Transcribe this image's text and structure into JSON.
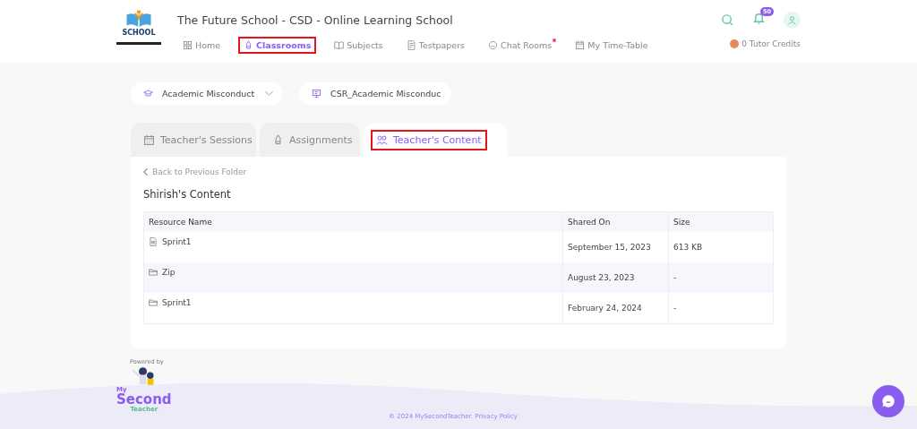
{
  "header": {
    "logo_text": "SCHOOL",
    "school_name": "The Future School - CSD - Online Learning School",
    "notification_count": "50",
    "tutor_credits": "0 Tutor Credits"
  },
  "nav": [
    {
      "label": "Home",
      "selected": false,
      "annotated": false,
      "dot": false
    },
    {
      "label": "Classrooms",
      "selected": true,
      "annotated": true,
      "dot": false
    },
    {
      "label": "Subjects",
      "selected": false,
      "annotated": false,
      "dot": false
    },
    {
      "label": "Testpapers",
      "selected": false,
      "annotated": false,
      "dot": false
    },
    {
      "label": "Chat Rooms",
      "selected": false,
      "annotated": false,
      "dot": true
    },
    {
      "label": "My Time-Table",
      "selected": false,
      "annotated": false,
      "dot": false
    }
  ],
  "dropdowns": [
    {
      "value": "Academic Misconduct"
    },
    {
      "value": "CSR_Academic Misconduc"
    }
  ],
  "tabs": [
    {
      "label": "Teacher's Sessions",
      "selected": false,
      "annotated": false
    },
    {
      "label": "Assignments",
      "selected": false,
      "annotated": false
    },
    {
      "label": "Teacher's Content",
      "selected": true,
      "annotated": true
    }
  ],
  "content": {
    "back_link": "Back to Previous Folder",
    "title": "Shirish's Content",
    "table": {
      "columns": [
        "Resource Name",
        "Shared On",
        "Size"
      ],
      "rows": [
        {
          "kind": "file",
          "cells": [
            "Sprint1",
            "September 15, 2023",
            "613 KB"
          ]
        },
        {
          "kind": "folder",
          "cells": [
            "Zip",
            "August 23, 2023",
            "-"
          ]
        },
        {
          "kind": "folder",
          "cells": [
            "Sprint1",
            "February 24, 2024",
            "-"
          ]
        }
      ]
    }
  },
  "footer": {
    "powered_by": "Powered by",
    "brand_top": "My",
    "brand_main": "Second",
    "brand_sub": "Teacher",
    "copyright": "© 2024 MySecondTeacher.",
    "privacy_link": "Privacy Policy"
  }
}
